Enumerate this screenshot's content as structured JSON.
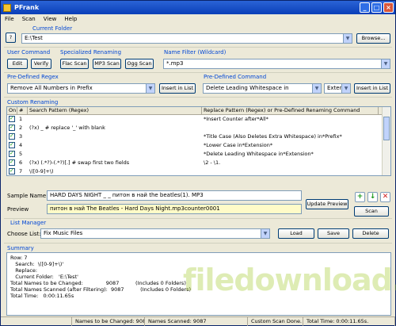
{
  "window": {
    "title": "PFrank"
  },
  "menu": [
    "File",
    "Scan",
    "View",
    "Help"
  ],
  "current_folder": {
    "label": "Current Folder",
    "value": "E:\\Test",
    "browse": "Browse..."
  },
  "help_button": "?",
  "user_command": {
    "label": "User Command",
    "edit": "Edit",
    "verify": "Verify"
  },
  "specialized": {
    "label": "Specialized Renaming",
    "flac": "Flac Scan",
    "mp3": "MP3 Scan",
    "ogg": "Ogg Scan"
  },
  "name_filter": {
    "label": "Name Filter (Wildcard)",
    "value": "*.mp3"
  },
  "predefined_regex": {
    "label": "Pre-Defined Regex",
    "value": "Remove All Numbers in Prefix",
    "insert": "Insert in List"
  },
  "predefined_command": {
    "label": "Pre-Defined Command",
    "value": "Delete Leading Whitespace in",
    "ext": "Extensi",
    "insert": "Insert in List"
  },
  "custom": {
    "label": "Custom Renaming",
    "headers": [
      "On",
      "#",
      "Search Pattern (Regex)",
      "Replace Pattern (Regex) or Pre-Defined Renaming Command"
    ],
    "rows": [
      {
        "num": "1",
        "search": "",
        "replace": "*Insert Counter after*All*"
      },
      {
        "num": "2",
        "search": "(?x) _                        # replace '_' with blank",
        "replace": ""
      },
      {
        "num": "3",
        "search": "",
        "replace": "*Title Case (Also Deletes Extra Whitespace) in*Prefix*"
      },
      {
        "num": "4",
        "search": "",
        "replace": "*Lower Case in*Extension*"
      },
      {
        "num": "5",
        "search": "",
        "replace": "*Delete Leading Whitespace in*Extension*"
      },
      {
        "num": "6",
        "search": "(?x) (.*?)-(.*?)[.]          # swap first two fields",
        "replace": "\\2 - \\1."
      },
      {
        "num": "7",
        "search": "\\([0-9]+\\)",
        "replace": ""
      }
    ]
  },
  "sample": {
    "label": "Sample Name",
    "value": "HARD DAYS NIGHT _ _ питон в най          the beatles(1). MP3",
    "preview_label": "Preview",
    "preview_value": "питон в най The Beatles - Hard Days Night.mp3counter0001",
    "update": "Update Preview",
    "scan": "Scan"
  },
  "list_manager": {
    "label": "List Manager",
    "choose": "Choose List:",
    "value": "Fix Music Files",
    "load": "Load",
    "save": "Save",
    "delete": "Delete"
  },
  "summary": {
    "label": "Summary",
    "lines": [
      "Row: 7",
      "   Search:  \\([0-9]+\\)'",
      "   Replace:",
      "",
      "   Current Folder:   'E:\\Test'",
      "",
      "Total Names to be Changed:              9087          (Includes 0 Folders)",
      "Total Names Scanned (after Filtering):  9087          (Includes 0 Folders)",
      "Total Time:   0:00:11.65s"
    ]
  },
  "status": {
    "changed": "Names to be Changed: 9087",
    "scanned": "Names Scanned: 9087",
    "done": "Custom Scan Done.",
    "time": "Total Time: 0:00:11.65s."
  },
  "watermark": "filedownload.com",
  "colors": {
    "group_label": "#0046d5",
    "preview_bg": "#fffbc8",
    "title_bar": "#0a3fb8"
  }
}
